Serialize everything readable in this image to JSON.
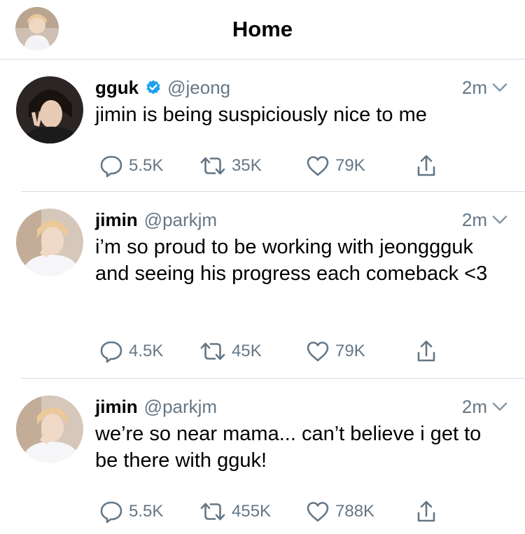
{
  "header": {
    "title": "Home",
    "avatar_icon": "user-avatar"
  },
  "colors": {
    "verified": "#1da1f2",
    "secondary": "#657786",
    "divider": "#d9dde1"
  },
  "tweets": [
    {
      "name": "gguk",
      "verified": true,
      "handle": "@jeong",
      "time": "2m",
      "text": "jimin is being suspiciously nice to me",
      "replies": "5.5K",
      "retweets": "35K",
      "likes": "79K"
    },
    {
      "name": "jimin",
      "verified": false,
      "handle": "@parkjm",
      "time": "2m",
      "text": "i’m so proud to be working with jeonggguk and seeing his progress each comeback <3",
      "replies": "4.5K",
      "retweets": "45K",
      "likes": "79K"
    },
    {
      "name": "jimin",
      "verified": false,
      "handle": "@parkjm",
      "time": "2m",
      "text": "we’re so near mama... can’t believe i get to be there with gguk!",
      "replies": "5.5K",
      "retweets": "455K",
      "likes": "788K"
    }
  ]
}
